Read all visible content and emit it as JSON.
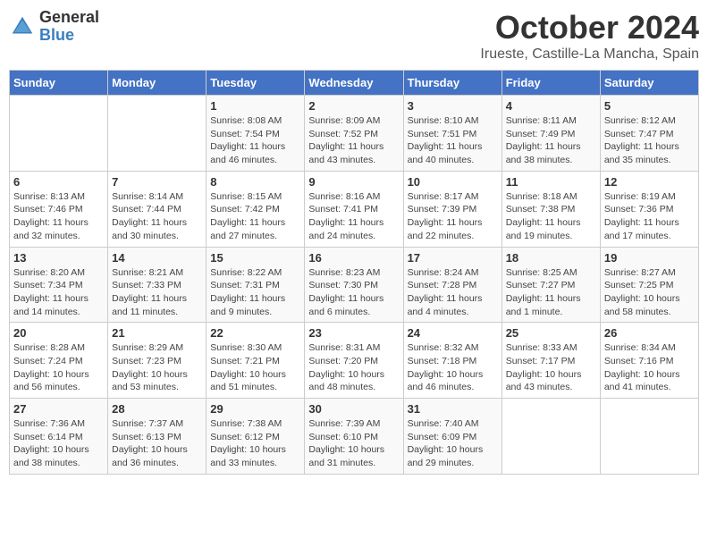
{
  "header": {
    "logo": {
      "general": "General",
      "blue": "Blue"
    },
    "month": "October 2024",
    "location": "Irueste, Castille-La Mancha, Spain"
  },
  "days_of_week": [
    "Sunday",
    "Monday",
    "Tuesday",
    "Wednesday",
    "Thursday",
    "Friday",
    "Saturday"
  ],
  "weeks": [
    [
      {
        "day": "",
        "info": ""
      },
      {
        "day": "",
        "info": ""
      },
      {
        "day": "1",
        "info": "Sunrise: 8:08 AM\nSunset: 7:54 PM\nDaylight: 11 hours and 46 minutes."
      },
      {
        "day": "2",
        "info": "Sunrise: 8:09 AM\nSunset: 7:52 PM\nDaylight: 11 hours and 43 minutes."
      },
      {
        "day": "3",
        "info": "Sunrise: 8:10 AM\nSunset: 7:51 PM\nDaylight: 11 hours and 40 minutes."
      },
      {
        "day": "4",
        "info": "Sunrise: 8:11 AM\nSunset: 7:49 PM\nDaylight: 11 hours and 38 minutes."
      },
      {
        "day": "5",
        "info": "Sunrise: 8:12 AM\nSunset: 7:47 PM\nDaylight: 11 hours and 35 minutes."
      }
    ],
    [
      {
        "day": "6",
        "info": "Sunrise: 8:13 AM\nSunset: 7:46 PM\nDaylight: 11 hours and 32 minutes."
      },
      {
        "day": "7",
        "info": "Sunrise: 8:14 AM\nSunset: 7:44 PM\nDaylight: 11 hours and 30 minutes."
      },
      {
        "day": "8",
        "info": "Sunrise: 8:15 AM\nSunset: 7:42 PM\nDaylight: 11 hours and 27 minutes."
      },
      {
        "day": "9",
        "info": "Sunrise: 8:16 AM\nSunset: 7:41 PM\nDaylight: 11 hours and 24 minutes."
      },
      {
        "day": "10",
        "info": "Sunrise: 8:17 AM\nSunset: 7:39 PM\nDaylight: 11 hours and 22 minutes."
      },
      {
        "day": "11",
        "info": "Sunrise: 8:18 AM\nSunset: 7:38 PM\nDaylight: 11 hours and 19 minutes."
      },
      {
        "day": "12",
        "info": "Sunrise: 8:19 AM\nSunset: 7:36 PM\nDaylight: 11 hours and 17 minutes."
      }
    ],
    [
      {
        "day": "13",
        "info": "Sunrise: 8:20 AM\nSunset: 7:34 PM\nDaylight: 11 hours and 14 minutes."
      },
      {
        "day": "14",
        "info": "Sunrise: 8:21 AM\nSunset: 7:33 PM\nDaylight: 11 hours and 11 minutes."
      },
      {
        "day": "15",
        "info": "Sunrise: 8:22 AM\nSunset: 7:31 PM\nDaylight: 11 hours and 9 minutes."
      },
      {
        "day": "16",
        "info": "Sunrise: 8:23 AM\nSunset: 7:30 PM\nDaylight: 11 hours and 6 minutes."
      },
      {
        "day": "17",
        "info": "Sunrise: 8:24 AM\nSunset: 7:28 PM\nDaylight: 11 hours and 4 minutes."
      },
      {
        "day": "18",
        "info": "Sunrise: 8:25 AM\nSunset: 7:27 PM\nDaylight: 11 hours and 1 minute."
      },
      {
        "day": "19",
        "info": "Sunrise: 8:27 AM\nSunset: 7:25 PM\nDaylight: 10 hours and 58 minutes."
      }
    ],
    [
      {
        "day": "20",
        "info": "Sunrise: 8:28 AM\nSunset: 7:24 PM\nDaylight: 10 hours and 56 minutes."
      },
      {
        "day": "21",
        "info": "Sunrise: 8:29 AM\nSunset: 7:23 PM\nDaylight: 10 hours and 53 minutes."
      },
      {
        "day": "22",
        "info": "Sunrise: 8:30 AM\nSunset: 7:21 PM\nDaylight: 10 hours and 51 minutes."
      },
      {
        "day": "23",
        "info": "Sunrise: 8:31 AM\nSunset: 7:20 PM\nDaylight: 10 hours and 48 minutes."
      },
      {
        "day": "24",
        "info": "Sunrise: 8:32 AM\nSunset: 7:18 PM\nDaylight: 10 hours and 46 minutes."
      },
      {
        "day": "25",
        "info": "Sunrise: 8:33 AM\nSunset: 7:17 PM\nDaylight: 10 hours and 43 minutes."
      },
      {
        "day": "26",
        "info": "Sunrise: 8:34 AM\nSunset: 7:16 PM\nDaylight: 10 hours and 41 minutes."
      }
    ],
    [
      {
        "day": "27",
        "info": "Sunrise: 7:36 AM\nSunset: 6:14 PM\nDaylight: 10 hours and 38 minutes."
      },
      {
        "day": "28",
        "info": "Sunrise: 7:37 AM\nSunset: 6:13 PM\nDaylight: 10 hours and 36 minutes."
      },
      {
        "day": "29",
        "info": "Sunrise: 7:38 AM\nSunset: 6:12 PM\nDaylight: 10 hours and 33 minutes."
      },
      {
        "day": "30",
        "info": "Sunrise: 7:39 AM\nSunset: 6:10 PM\nDaylight: 10 hours and 31 minutes."
      },
      {
        "day": "31",
        "info": "Sunrise: 7:40 AM\nSunset: 6:09 PM\nDaylight: 10 hours and 29 minutes."
      },
      {
        "day": "",
        "info": ""
      },
      {
        "day": "",
        "info": ""
      }
    ]
  ]
}
